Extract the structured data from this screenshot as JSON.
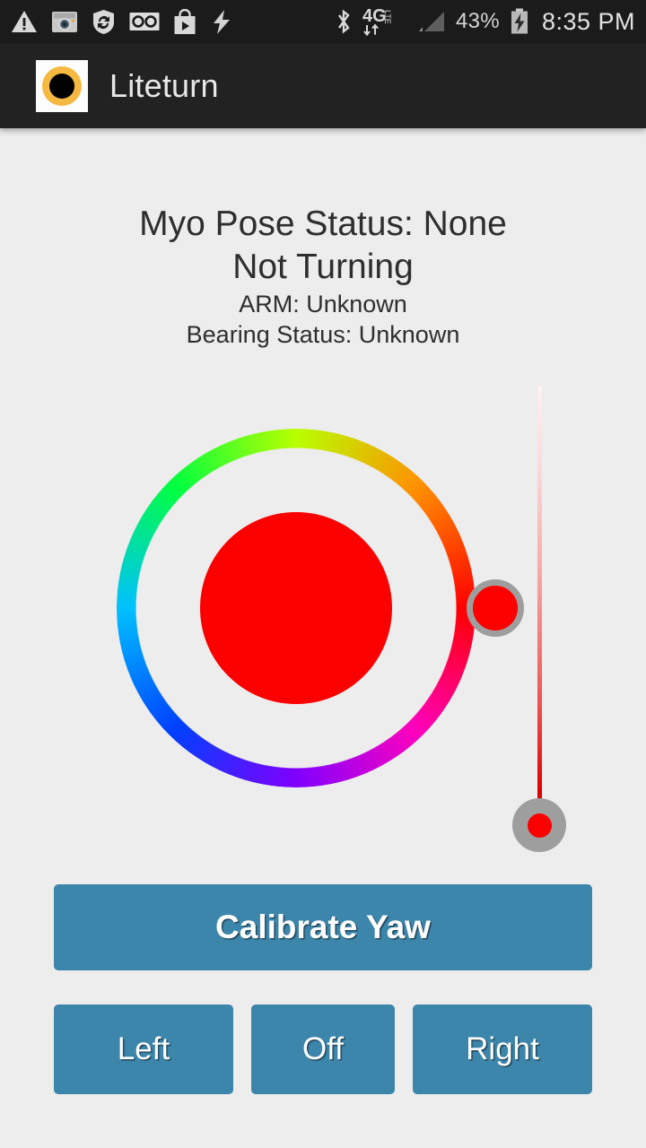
{
  "statusbar": {
    "left_icons": [
      "warning-triangle-icon",
      "camera-icon",
      "shield-sync-icon",
      "voicemail-icon",
      "play-store-icon",
      "lightning-bolt-icon"
    ],
    "right_icons": [
      "bluetooth-icon",
      "network-4g-lte-icon",
      "signal-bars-icon",
      "battery-charging-icon"
    ],
    "battery_percent": "43%",
    "network_label": "4G",
    "network_sub_label": "LTE",
    "clock": "8:35 PM",
    "background_color": "#1b1b1b",
    "text_color": "#d4d4d4"
  },
  "actionbar": {
    "app_title": "Liteturn",
    "logo_icon": "liteturn-ring-icon",
    "logo_ring_color": "#f5b942",
    "logo_core_color": "#020202",
    "background_color": "#222222"
  },
  "status": {
    "pose_status": "Myo Pose Status: None",
    "turning_status": "Not Turning",
    "arm_status": "ARM: Unknown",
    "bearing_status": "Bearing Status: Unknown",
    "text_color": "#2e2e2e"
  },
  "colorwheel": {
    "name": "hue-color-wheel",
    "selected_color": "#fc0000",
    "knob_color": "#fc0000",
    "knob_border_color": "#9e9e9e",
    "center_preview_color": "#fc0000",
    "selected_hue_degrees": 0,
    "knob_position_clock": "3 o'clock"
  },
  "brightness_slider": {
    "name": "brightness-slider",
    "orientation": "vertical",
    "value_position": "bottom",
    "track_top_color": "#fdf1f1",
    "track_bottom_color": "#c00000",
    "knob_color": "#9e9e9e",
    "knob_dot_color": "#fc0000"
  },
  "buttons": {
    "calibrate_label": "Calibrate Yaw",
    "left_label": "Left",
    "off_label": "Off",
    "right_label": "Right",
    "accent_color": "#3d86ab",
    "text_color": "#ffffff"
  },
  "page": {
    "background_color": "#ededed"
  }
}
